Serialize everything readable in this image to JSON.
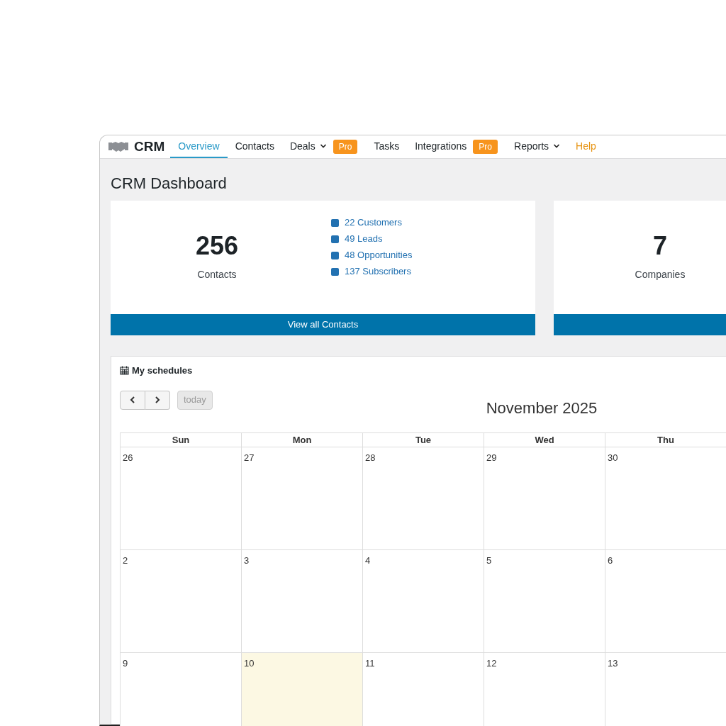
{
  "nav": {
    "brand": "CRM",
    "items": [
      {
        "label": "Overview",
        "selected": true,
        "kind": "link"
      },
      {
        "label": "Contacts",
        "selected": false,
        "kind": "link"
      },
      {
        "label": "Deals",
        "selected": false,
        "kind": "dropdown",
        "badge": "Pro"
      },
      {
        "label": "Tasks",
        "selected": false,
        "kind": "link"
      },
      {
        "label": "Integrations",
        "selected": false,
        "kind": "link",
        "badge": "Pro"
      },
      {
        "label": "Reports",
        "selected": false,
        "kind": "dropdown"
      },
      {
        "label": "Help",
        "selected": false,
        "kind": "help"
      }
    ]
  },
  "page_title": "CRM Dashboard",
  "cards": [
    {
      "value": "256",
      "label": "Contacts",
      "links": [
        "22 Customers",
        "49 Leads",
        "48 Opportunities",
        "137 Subscribers"
      ],
      "button": "View all Contacts"
    },
    {
      "value": "7",
      "label": "Companies"
    }
  ],
  "schedules": {
    "title": "My schedules",
    "today_button": {
      "label": "today",
      "disabled": true
    },
    "month": "November 2025",
    "weekdays": [
      "Sun",
      "Mon",
      "Tue",
      "Wed",
      "Thu"
    ],
    "weeks": [
      [
        {
          "day": "26",
          "today": false
        },
        {
          "day": "27",
          "today": false
        },
        {
          "day": "28",
          "today": false
        },
        {
          "day": "29",
          "today": false
        },
        {
          "day": "30",
          "today": false
        }
      ],
      [
        {
          "day": "2",
          "today": false
        },
        {
          "day": "3",
          "today": false
        },
        {
          "day": "4",
          "today": false
        },
        {
          "day": "5",
          "today": false
        },
        {
          "day": "6",
          "today": false
        }
      ],
      [
        {
          "day": "9",
          "today": false
        },
        {
          "day": "10",
          "today": true
        },
        {
          "day": "11",
          "today": false
        },
        {
          "day": "12",
          "today": false
        },
        {
          "day": "13",
          "today": false
        }
      ]
    ]
  }
}
